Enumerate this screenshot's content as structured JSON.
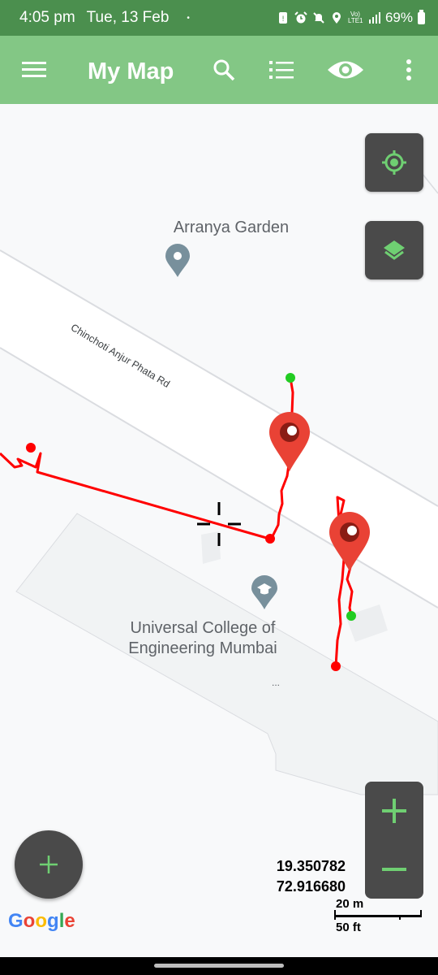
{
  "status_bar": {
    "time": "4:05 pm",
    "date": "Tue, 13 Feb",
    "dot": "•",
    "network_label": "Vo) LTE1",
    "battery": "69%",
    "icons": [
      "sim-alert-icon",
      "alarm-icon",
      "mute-icon",
      "location-icon",
      "volte-icon",
      "signal-icon",
      "battery-icon"
    ]
  },
  "app_bar": {
    "title": "My Map",
    "icons": [
      "menu-icon",
      "search-icon",
      "list-icon",
      "eye-icon",
      "more-vert-icon"
    ]
  },
  "map": {
    "places": [
      {
        "name": "Arranya Garden",
        "icon": "place-pin-icon"
      },
      {
        "name": "Universal College of\nEngineering Mumbai",
        "icon": "school-pin-icon"
      }
    ],
    "road_name": "Chinchoti Anjur Phata Rd",
    "ellipsis": "...",
    "colors": {
      "track": "#ff0000",
      "track_start": "#22cc22",
      "marker": "#e94235",
      "fab_bg": "#4a4a4a",
      "fab_icon": "#6fcf72",
      "app_bar": "#83c785",
      "status_bar": "#4b8f4e"
    }
  },
  "controls": {
    "my_location": "my-location-icon",
    "layers": "layers-icon",
    "zoom_in": "+",
    "zoom_out": "−",
    "add": "+"
  },
  "coordinates": {
    "lat": "19.350782",
    "lng": "72.916680"
  },
  "scale": {
    "metric": "20 m",
    "imperial": "50 ft"
  },
  "attribution": {
    "letters": [
      {
        "ch": "G",
        "color": "#4285f4"
      },
      {
        "ch": "o",
        "color": "#ea4335"
      },
      {
        "ch": "o",
        "color": "#fbbc05"
      },
      {
        "ch": "g",
        "color": "#4285f4"
      },
      {
        "ch": "l",
        "color": "#34a853"
      },
      {
        "ch": "e",
        "color": "#ea4335"
      }
    ]
  }
}
